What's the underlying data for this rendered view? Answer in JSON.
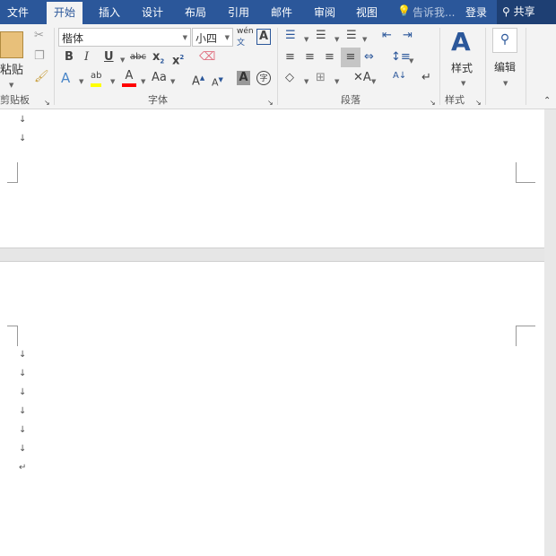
{
  "tabs": [
    "文件",
    "开始",
    "插入",
    "设计",
    "布局",
    "引用",
    "邮件",
    "审阅",
    "视图"
  ],
  "active_tab": "开始",
  "tell_me": "告诉我...",
  "login": "登录",
  "share": "共享",
  "clipboard": {
    "paste": "粘贴",
    "group": "剪贴板"
  },
  "font": {
    "name": "楷体",
    "size": "小四",
    "group": "字体",
    "wen": "wén",
    "wen_char": "文"
  },
  "paragraph": {
    "group": "段落"
  },
  "styles": {
    "label": "样式",
    "group": "样式"
  },
  "editing": {
    "label": "编辑"
  },
  "doc": {
    "para_mark": "↓",
    "end_mark": "↵"
  },
  "colors": {
    "accent": "#2b579a",
    "highlight": "#ffff00",
    "font_color": "#ff0000"
  }
}
